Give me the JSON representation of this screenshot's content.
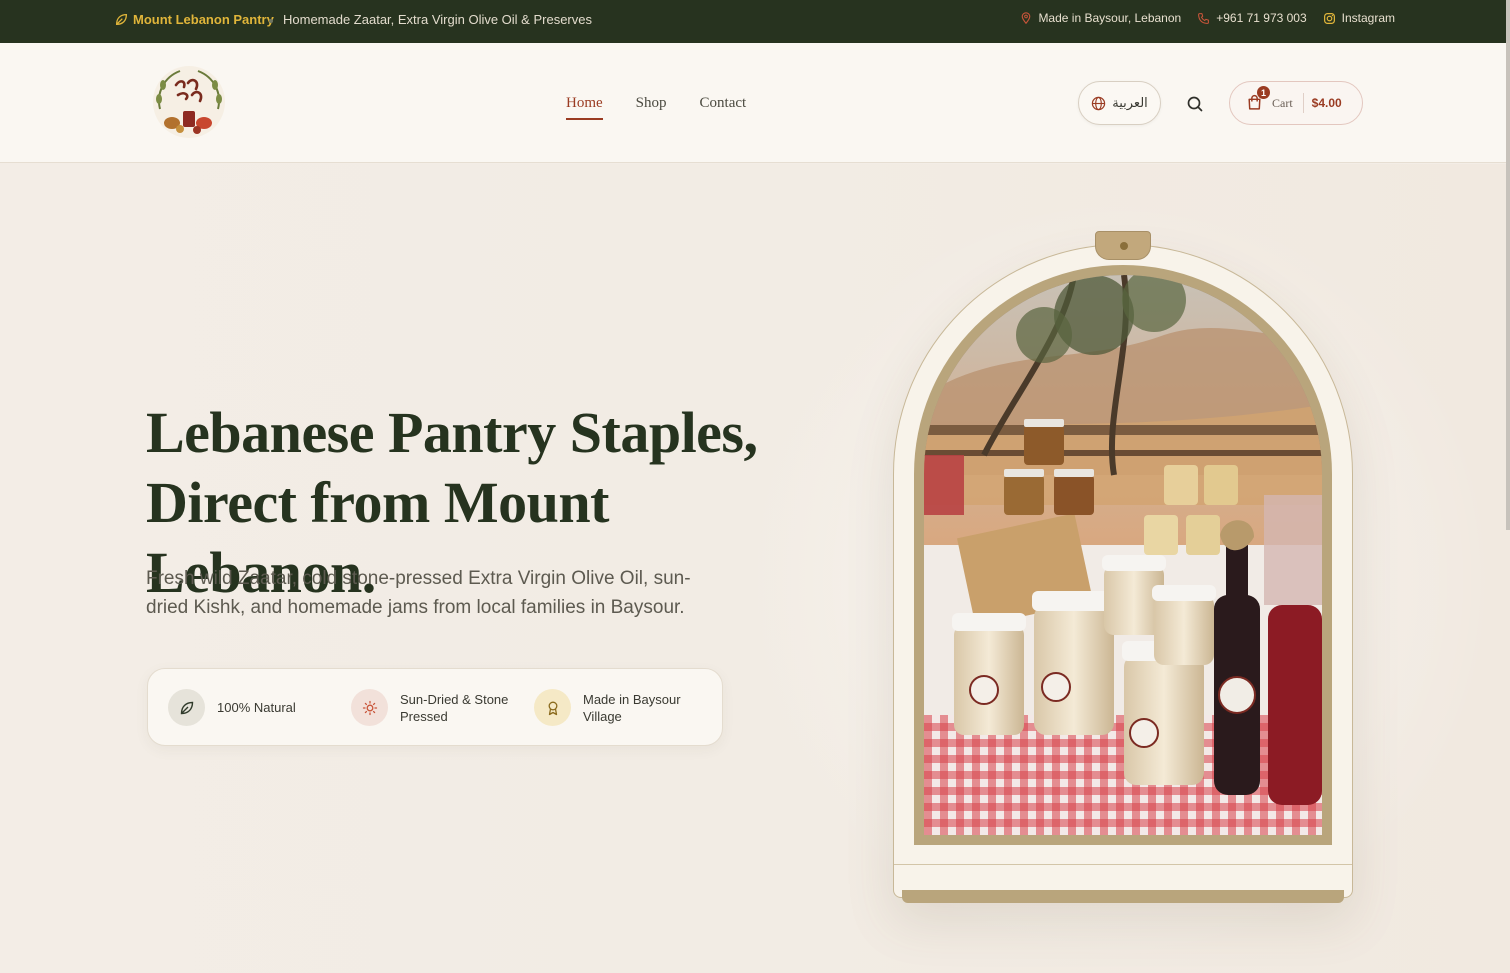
{
  "topbar": {
    "brand": "Mount Lebanon Pantry",
    "tagline": "Homemade Zaatar, Extra Virgin Olive Oil & Preserves",
    "location": "Made in Baysour, Lebanon",
    "phone": "+961 71 973 003",
    "instagram": "Instagram"
  },
  "header": {
    "logo_alt": "Rooh w Rayhan logo",
    "nav": [
      "Home",
      "Shop",
      "Contact"
    ],
    "language": "العربية",
    "cart": {
      "label": "Cart",
      "count": "1",
      "total": "$4.00"
    }
  },
  "hero": {
    "title_line1": "Lebanese Pantry Staples,",
    "title_line2": "Direct from Mount Lebanon.",
    "lead": "Fresh wild Zaatar, cold stone-pressed Extra Virgin Olive Oil, sun-dried Kishk, and homemade jams from local families in Baysour.",
    "features": [
      "100% Natural",
      "Sun-Dried & Stone Pressed",
      "Made in Baysour Village"
    ]
  },
  "colors": {
    "accent": "#9a3b22",
    "dark_green": "#27331f",
    "gold": "#b9a57c",
    "cream": "#f3ede6"
  }
}
